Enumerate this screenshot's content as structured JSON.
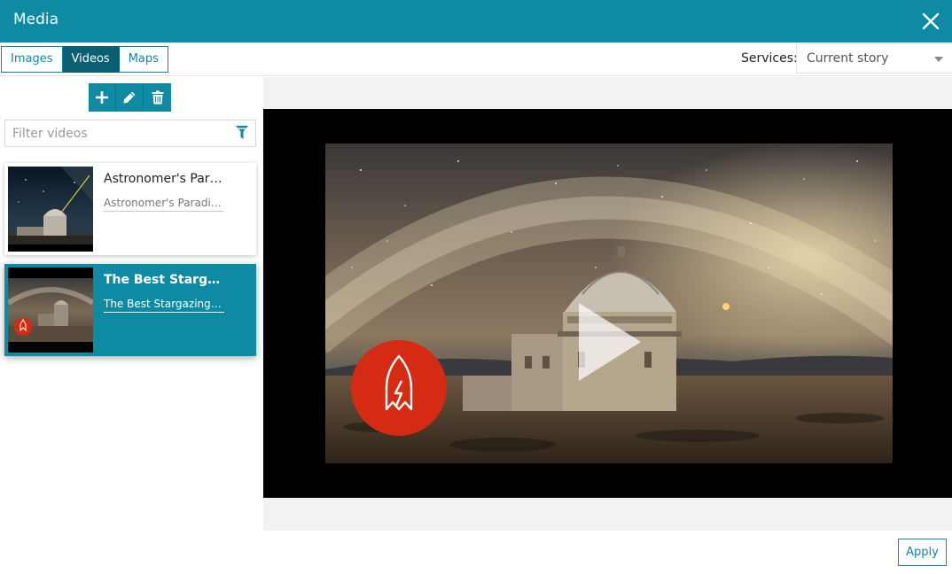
{
  "header": {
    "title": "Media",
    "close_icon": "close-icon"
  },
  "tabs": [
    {
      "label": "Images",
      "active": false
    },
    {
      "label": "Videos",
      "active": true
    },
    {
      "label": "Maps",
      "active": false
    }
  ],
  "services": {
    "label": "Services:",
    "selected": "Current story"
  },
  "actions": {
    "add_icon": "plus-icon",
    "edit_icon": "pencil-icon",
    "delete_icon": "trash-icon"
  },
  "filter": {
    "placeholder": "Filter videos",
    "value": "",
    "icon": "funnel-icon"
  },
  "videos": [
    {
      "title": "Astronomer's Paradise",
      "description": "Astronomer's Paradise ...",
      "selected": false
    },
    {
      "title": "The Best Stargazing...",
      "description": "The Best Stargazing is ...",
      "selected": true
    }
  ],
  "preview": {
    "play_icon": "play-icon",
    "logo": "rocket-logo"
  },
  "footer": {
    "apply_label": "Apply"
  },
  "colors": {
    "primary": "#0e8aa3",
    "active_tab": "#0b5f73",
    "logo_red": "#d42b12"
  }
}
